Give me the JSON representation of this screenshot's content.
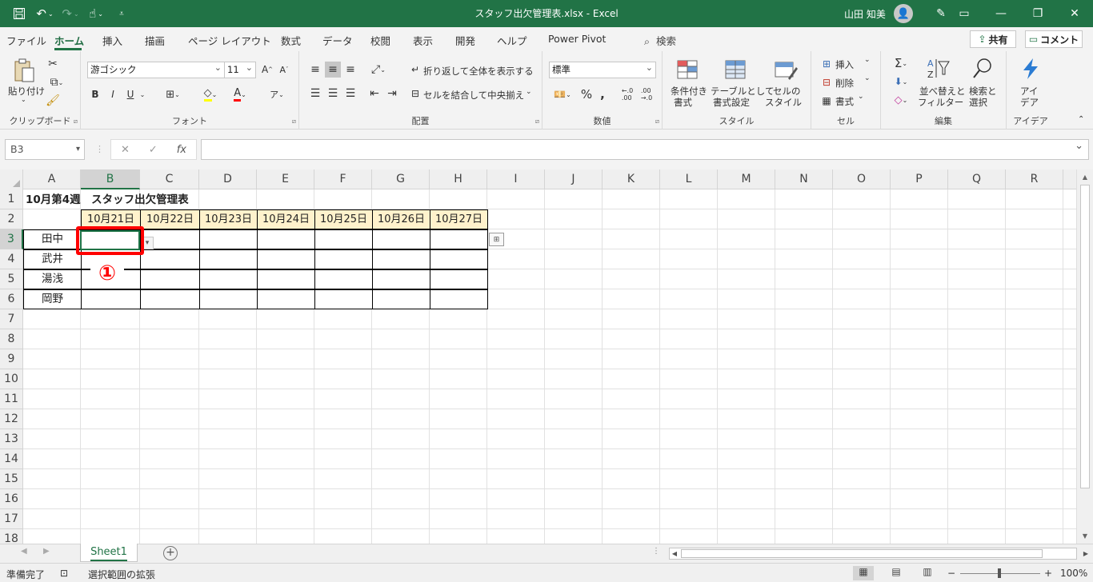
{
  "window": {
    "title": "スタッフ出欠管理表.xlsx  -  Excel",
    "user_name": "山田 知美"
  },
  "menu_tabs": [
    "ファイル",
    "ホーム",
    "挿入",
    "描画",
    "ページ レイアウト",
    "数式",
    "データ",
    "校閲",
    "表示",
    "開発",
    "ヘルプ",
    "Power Pivot"
  ],
  "search_label": "検索",
  "share_label": "共有",
  "comment_label": "コメント",
  "ribbon": {
    "clipboard": {
      "paste": "貼り付け",
      "group": "クリップボード"
    },
    "font": {
      "name": "游ゴシック",
      "size": "11",
      "group": "フォント",
      "bold": "B",
      "italic": "I",
      "underline": "U"
    },
    "alignment": {
      "wrap": "折り返して全体を表示する",
      "merge": "セルを結合して中央揃え",
      "group": "配置"
    },
    "number": {
      "format": "標準",
      "group": "数値"
    },
    "styles": {
      "cond1": "条件付き",
      "cond2": "書式",
      "table1": "テーブルとして",
      "table2": "書式設定",
      "cell1": "セルの",
      "cell2": "スタイル",
      "group": "スタイル"
    },
    "cells": {
      "insert": "挿入",
      "delete": "削除",
      "format": "書式",
      "group": "セル"
    },
    "editing": {
      "sort1": "並べ替えと",
      "sort2": "フィルター",
      "find1": "検索と",
      "find2": "選択",
      "group": "編集"
    },
    "ideas": {
      "label1": "アイ",
      "label2": "デア",
      "group": "アイデア"
    }
  },
  "formula_bar": {
    "name_box": "B3",
    "formula": ""
  },
  "columns": [
    "A",
    "B",
    "C",
    "D",
    "E",
    "F",
    "G",
    "H",
    "I",
    "J",
    "K",
    "L",
    "M",
    "N",
    "O",
    "P",
    "Q",
    "R"
  ],
  "rows": [
    "1",
    "2",
    "3",
    "4",
    "5",
    "6",
    "7",
    "8",
    "9",
    "10",
    "11",
    "12",
    "13",
    "14",
    "15",
    "16",
    "17",
    "18"
  ],
  "sheet": {
    "title": "10月第4週　スタッフ出欠管理表",
    "dates": [
      "10月21日",
      "10月22日",
      "10月23日",
      "10月24日",
      "10月25日",
      "10月26日",
      "10月27日"
    ],
    "staff": [
      "田中",
      "武井",
      "湯浅",
      "岡野"
    ]
  },
  "annotation": {
    "callout": "①",
    "color": "#ff0000"
  },
  "sheet_tabs": [
    "Sheet1"
  ],
  "status": {
    "ready": "準備完了",
    "mode": "選択範囲の拡張",
    "zoom": "100%"
  },
  "colors": {
    "accent": "#217346",
    "date_fill": "#fff2cc"
  }
}
